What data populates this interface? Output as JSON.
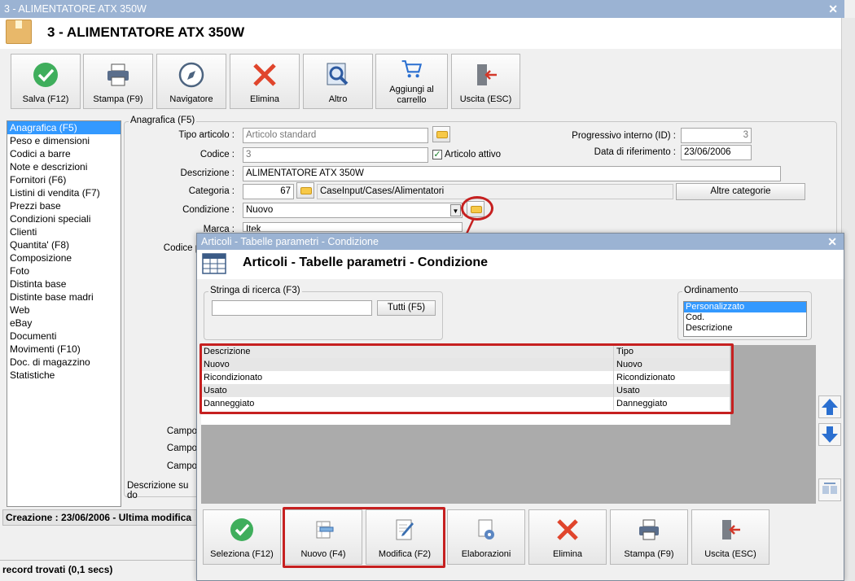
{
  "main": {
    "window_title": "3 - ALIMENTATORE ATX 350W",
    "header_title": "3 - ALIMENTATORE ATX 350W",
    "toolbar": [
      {
        "label": "Salva (F12)",
        "icon": "check-icon"
      },
      {
        "label": "Stampa (F9)",
        "icon": "printer-icon"
      },
      {
        "label": "Navigatore",
        "icon": "compass-icon"
      },
      {
        "label": "Elimina",
        "icon": "delete-x-icon"
      },
      {
        "label": "Altro",
        "icon": "magnifier-icon"
      },
      {
        "label": "Aggiungi al carrello",
        "icon": "cart-icon"
      },
      {
        "label": "Uscita (ESC)",
        "icon": "exit-door-icon"
      }
    ],
    "nav_items": [
      "Anagrafica (F5)",
      "Peso e dimensioni",
      "Codici a barre",
      "Note e descrizioni",
      "Fornitori (F6)",
      "Listini di vendita (F7)",
      "Prezzi base",
      "Condizioni speciali",
      "Clienti",
      "Quantita' (F8)",
      "Composizione",
      "Foto",
      "Distinta base",
      "Distinte base madri",
      "Web",
      "eBay",
      "Documenti",
      "Movimenti (F10)",
      "Doc. di magazzino",
      "Statistiche"
    ],
    "group_title": "Anagrafica (F5)",
    "form": {
      "tipo_label": "Tipo articolo :",
      "tipo_value": "Articolo standard",
      "codice_label": "Codice :",
      "codice_value": "3",
      "articolo_attivo_label": "Articolo attivo",
      "descrizione_label": "Descrizione :",
      "descrizione_value": "ALIMENTATORE ATX 350W",
      "categoria_label": "Categoria :",
      "categoria_value": "67",
      "categoria_path": "CaseInput/Cases/Alimentatori",
      "altre_categorie": "Altre categorie",
      "condizione_label": "Condizione :",
      "condizione_value": "Nuovo",
      "marca_label": "Marca :",
      "marca_value": "Itek",
      "codice_pr_label": "Codice pr",
      "progressivo_label": "Progressivo interno (ID) :",
      "progressivo_value": "3",
      "data_label": "Data di riferimento :",
      "data_value": "23/06/2006",
      "campo1": "Campo",
      "campo2": "Campo",
      "campo3": "Campo",
      "descr_su_doc": "Descrizione su do"
    },
    "status_creation": "Creazione : 23/06/2006 - Ultima modifica",
    "status_records": "record trovati (0,1 secs)"
  },
  "dialog": {
    "window_title": "Articoli - Tabelle parametri - Condizione",
    "header_title": "Articoli - Tabelle parametri - Condizione",
    "search_group": "Stringa di ricerca (F3)",
    "search_value": "",
    "tutti_button": "Tutti (F5)",
    "order_group": "Ordinamento",
    "order_options": [
      "Personalizzato",
      "Cod.",
      "Descrizione"
    ],
    "columns": [
      "Descrizione",
      "Tipo"
    ],
    "rows": [
      [
        "Nuovo",
        "Nuovo"
      ],
      [
        "Ricondizionato",
        "Ricondizionato"
      ],
      [
        "Usato",
        "Usato"
      ],
      [
        "Danneggiato",
        "Danneggiato"
      ]
    ],
    "buttons": [
      {
        "label": "Seleziona (F12)",
        "icon": "check-icon"
      },
      {
        "label": "Nuovo (F4)",
        "icon": "new-row-icon"
      },
      {
        "label": "Modifica (F2)",
        "icon": "edit-pencil-icon"
      },
      {
        "label": "Elaborazioni",
        "icon": "gear-document-icon"
      },
      {
        "label": "Elimina",
        "icon": "delete-x-icon"
      },
      {
        "label": "Stampa (F9)",
        "icon": "printer-icon"
      },
      {
        "label": "Uscita (ESC)",
        "icon": "exit-door-icon"
      }
    ]
  },
  "colors": {
    "accent_red": "#c62020",
    "selection": "#3399ff",
    "titlebar": "#9bb3d3"
  }
}
